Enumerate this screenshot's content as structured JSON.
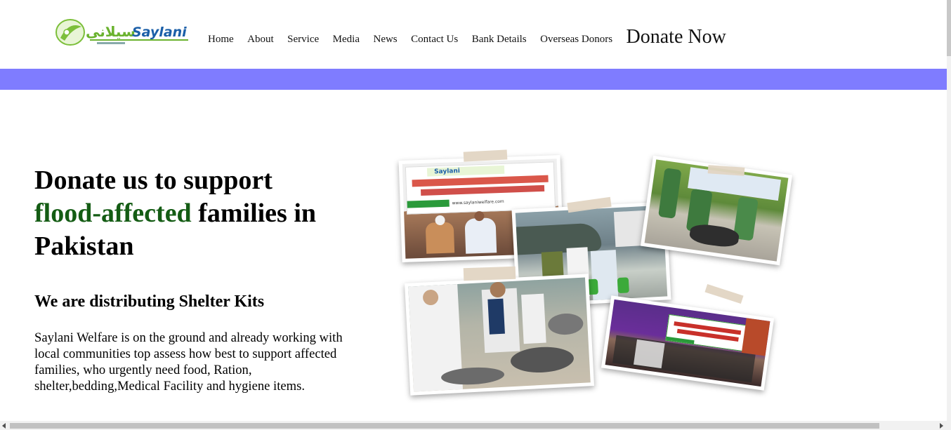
{
  "header": {
    "logo_urdu": "سیلانی",
    "logo_en": "Saylani",
    "nav": [
      {
        "label": "Home"
      },
      {
        "label": "About"
      },
      {
        "label": "Service"
      },
      {
        "label": "Media"
      },
      {
        "label": "News"
      },
      {
        "label": "Contact Us"
      },
      {
        "label": "Bank Details"
      },
      {
        "label": "Overseas Donors"
      }
    ],
    "donate_label": "Donate Now"
  },
  "hero": {
    "title_line1": "Donate us to support",
    "title_green": "flood-affected",
    "title_rest": " families in",
    "title_line3": "Pakistan",
    "subtitle": "We are distributing Shelter Kits",
    "body": "Saylani Welfare is on the ground and already working with local communities top assess how best to support affected families, who urgently need food, Ration, shelter,bedding,Medical Facility and hygiene items."
  },
  "colors": {
    "band": "#7f7cff",
    "green_text": "#145c14",
    "logo_green": "#7cbf3a",
    "logo_blue": "#1b5fa8"
  },
  "collage": {
    "banner_brand": "Saylani",
    "site": "www.saylaniwelfare.com"
  }
}
